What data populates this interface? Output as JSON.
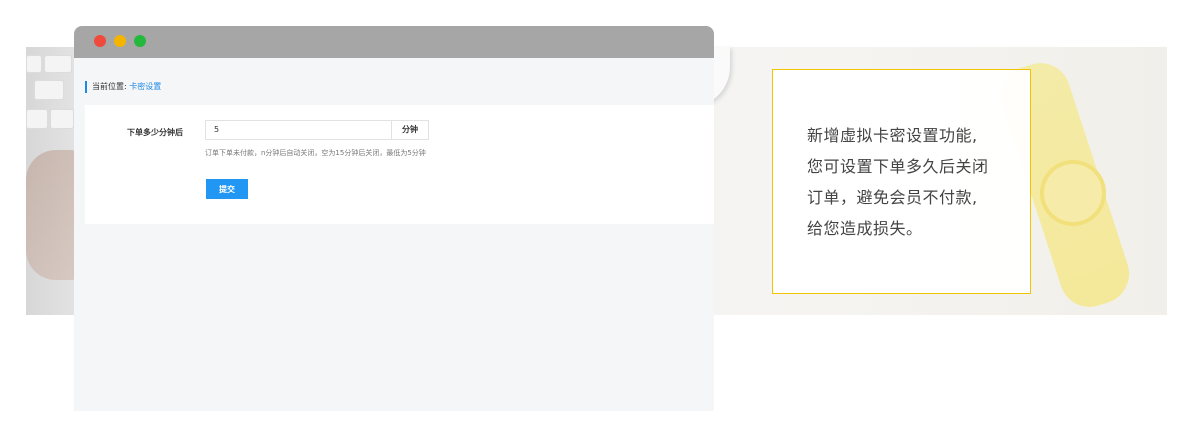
{
  "breadcrumb": {
    "prefix": "当前位置:",
    "current": "卡密设置"
  },
  "form": {
    "label": "下单多少分钟后",
    "value": "5",
    "unit": "分钟",
    "help": "订单下单未付款，n分钟后自动关闭，空为15分钟后关闭，最低为5分钟",
    "submit_label": "提交"
  },
  "promo": {
    "lines": [
      "新增虚拟卡密设置功能,",
      "您可设置下单多久后关闭",
      "订单，避免会员不付款,",
      "给您造成损失。"
    ],
    "border_color": "#f0c400"
  },
  "colors": {
    "accent": "#1e88e5",
    "button": "#2196f3",
    "titlebar": "#a6a6a6"
  },
  "icons": {
    "window_controls": [
      "close-dot",
      "minimize-dot",
      "maximize-dot"
    ]
  }
}
